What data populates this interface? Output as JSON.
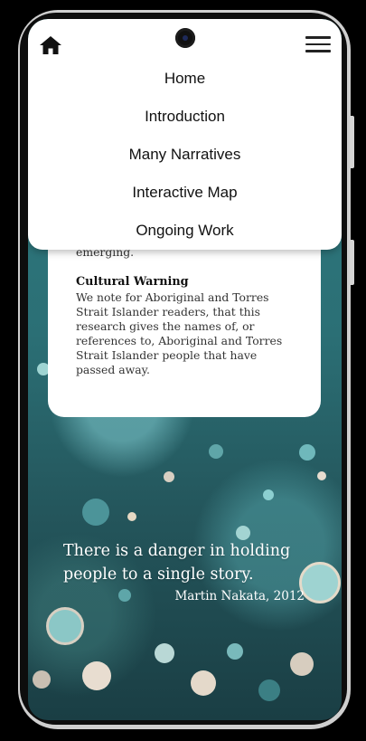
{
  "nav": {
    "menu_items": [
      "Home",
      "Introduction",
      "Many Narratives",
      "Interactive Map",
      "Ongoing Work"
    ]
  },
  "card": {
    "partial_text": "emerging.",
    "warning_title": "Cultural Warning",
    "warning_body": "We note for Aboriginal and Torres Strait Islander readers, that this research gives the names of, or references to, Aboriginal and Torres Strait Islander people that have passed away."
  },
  "quote": {
    "text": "There is a danger in holding people to a single story.",
    "attribution": "Martin Nakata, 2012"
  },
  "colors": {
    "background_teal": "#2f7d82",
    "menu_background": "#ffffff",
    "text_dark": "#111111"
  }
}
